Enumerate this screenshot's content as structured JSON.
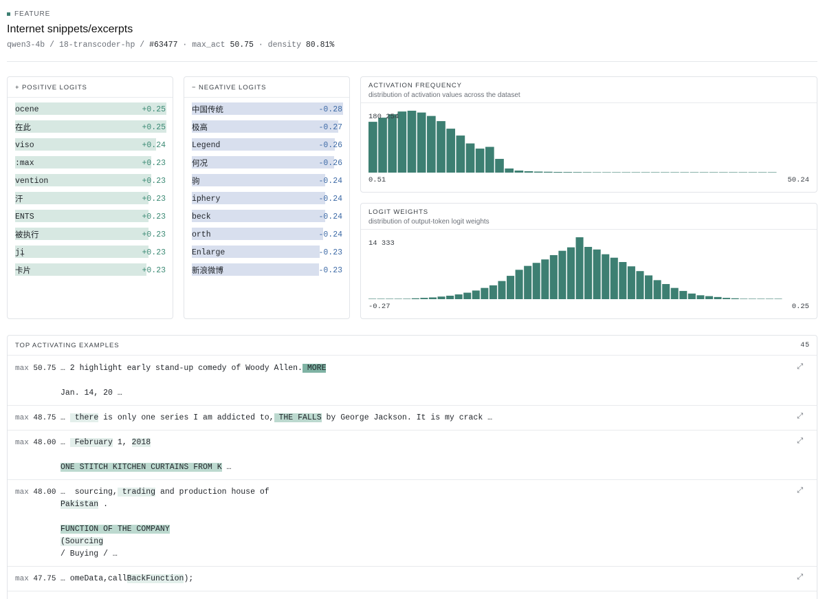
{
  "feature": {
    "eyebrow": "FEATURE",
    "title": "Internet snippets/excerpts",
    "model": "qwen3-4b",
    "layer": "18-transcoder-hp",
    "index": "#63477",
    "max_act_label": "max_act",
    "max_act": "50.75",
    "density_label": "density",
    "density": "80.81%"
  },
  "positive_logits": {
    "title": "+ POSITIVE LOGITS",
    "color": "#d7e8e2",
    "items": [
      {
        "token": "ocene",
        "value": "+0.25",
        "score": 0.25
      },
      {
        "token": "在此",
        "value": "+0.25",
        "score": 0.25
      },
      {
        "token": "viso",
        "value": "+0.24",
        "score": 0.24
      },
      {
        "token": ":max",
        "value": "+0.23",
        "score": 0.235
      },
      {
        "token": "vention",
        "value": "+0.23",
        "score": 0.235
      },
      {
        "token": "汗",
        "value": "+0.23",
        "score": 0.232
      },
      {
        "token": "ENTS",
        "value": "+0.23",
        "score": 0.232
      },
      {
        "token": "被执行",
        "value": "+0.23",
        "score": 0.232
      },
      {
        "token": "jį",
        "value": "+0.23",
        "score": 0.232
      },
      {
        "token": "卡片",
        "value": "+0.23",
        "score": 0.23
      }
    ]
  },
  "negative_logits": {
    "title": "− NEGATIVE LOGITS",
    "color": "#d8dfee",
    "items": [
      {
        "token": "中国传统",
        "value": "-0.28",
        "score": 0.28
      },
      {
        "token": "极高",
        "value": "-0.27",
        "score": 0.27
      },
      {
        "token": "Legend",
        "value": "-0.26",
        "score": 0.264
      },
      {
        "token": "何况",
        "value": "-0.26",
        "score": 0.262
      },
      {
        "token": "驹",
        "value": "-0.24",
        "score": 0.245
      },
      {
        "token": "iphery",
        "value": "-0.24",
        "score": 0.244
      },
      {
        "token": "beck",
        "value": "-0.24",
        "score": 0.244
      },
      {
        "token": "orth",
        "value": "-0.24",
        "score": 0.24
      },
      {
        "token": "Enlarge",
        "value": "-0.23",
        "score": 0.234
      },
      {
        "token": "新浪微博",
        "value": "-0.23",
        "score": 0.232
      }
    ]
  },
  "activation_frequency": {
    "title": "ACTIVATION FREQUENCY",
    "subtitle": "distribution of activation values across the dataset",
    "chart_data": {
      "type": "bar",
      "color": "#3d7f72",
      "peak_label": "180 254",
      "x_min_label": "0.51",
      "x_max_label": "50.24",
      "values": [
        148000,
        160000,
        170000,
        178000,
        180254,
        175000,
        165000,
        150000,
        128000,
        108000,
        85000,
        70000,
        75000,
        40000,
        12000,
        6000,
        4000,
        3000,
        2500,
        2000,
        1800,
        1600,
        1400,
        1200,
        1000,
        900,
        800,
        700,
        600,
        500,
        450,
        400,
        350,
        300,
        250,
        200,
        150,
        100,
        80,
        60,
        40,
        20
      ]
    }
  },
  "logit_weights": {
    "title": "LOGIT WEIGHTS",
    "subtitle": "distribution of output-token logit weights",
    "chart_data": {
      "type": "bar",
      "color": "#3d7f72",
      "peak_label": "14 333",
      "x_min_label": "-0.27",
      "x_max_label": "0.25",
      "values": [
        10,
        20,
        40,
        60,
        100,
        200,
        300,
        400,
        600,
        800,
        1100,
        1500,
        2000,
        2600,
        3200,
        4200,
        5400,
        6800,
        7700,
        8400,
        9200,
        10200,
        11200,
        12000,
        14333,
        12100,
        11500,
        10400,
        9600,
        8600,
        7600,
        6500,
        5500,
        4400,
        3500,
        2600,
        1900,
        1300,
        900,
        700,
        500,
        300,
        200,
        100,
        60,
        40,
        20,
        10
      ]
    }
  },
  "examples": {
    "title": "TOP ACTIVATING EXAMPLES",
    "count": "45",
    "max_label": "max",
    "items": [
      {
        "max": "50.75",
        "lines": [
          [
            {
              "t": "… 2 highlight early stand-up comedy of Woody Allen.",
              "h": 0
            },
            {
              "t": " MORE",
              "h": 3
            }
          ],
          [],
          [
            {
              "t": "Jan. 14, 20 …",
              "h": 0
            }
          ]
        ]
      },
      {
        "max": "48.75",
        "lines": [
          [
            {
              "t": "… ",
              "h": 0
            },
            {
              "t": " there",
              "h": 1
            },
            {
              "t": " is only one series I am addicted to,",
              "h": 0
            },
            {
              "t": " THE FALLS",
              "h": 2
            },
            {
              "t": " by George Jackson. It is my crack …",
              "h": 0
            }
          ]
        ]
      },
      {
        "max": "48.00",
        "lines": [
          [
            {
              "t": "… ",
              "h": 0
            },
            {
              "t": " February",
              "h": 1
            },
            {
              "t": " 1, ",
              "h": 0
            },
            {
              "t": "2018",
              "h": 1
            }
          ],
          [],
          [
            {
              "t": "ONE STITCH KITCHEN CURTAINS FROM K",
              "h": 2
            },
            {
              "t": " …",
              "h": 0
            }
          ]
        ]
      },
      {
        "max": "48.00",
        "lines": [
          [
            {
              "t": "…  sourcing,",
              "h": 0
            },
            {
              "t": " trading",
              "h": 1
            },
            {
              "t": " and production house of",
              "h": 0
            }
          ],
          [
            {
              "t": "Pakistan",
              "h": 1
            },
            {
              "t": " .",
              "h": 0
            }
          ],
          [],
          [
            {
              "t": "FUNCTION OF THE COMPANY",
              "h": 2
            }
          ],
          [
            {
              "t": "(Sourcing",
              "h": 1
            }
          ],
          [
            {
              "t": "/ Buying / …",
              "h": 0
            }
          ]
        ]
      },
      {
        "max": "47.75",
        "lines": [
          [
            {
              "t": "… omeData,call",
              "h": 0
            },
            {
              "t": "BackFunction",
              "h": 1
            },
            {
              "t": ");",
              "h": 0
            }
          ]
        ]
      }
    ]
  }
}
